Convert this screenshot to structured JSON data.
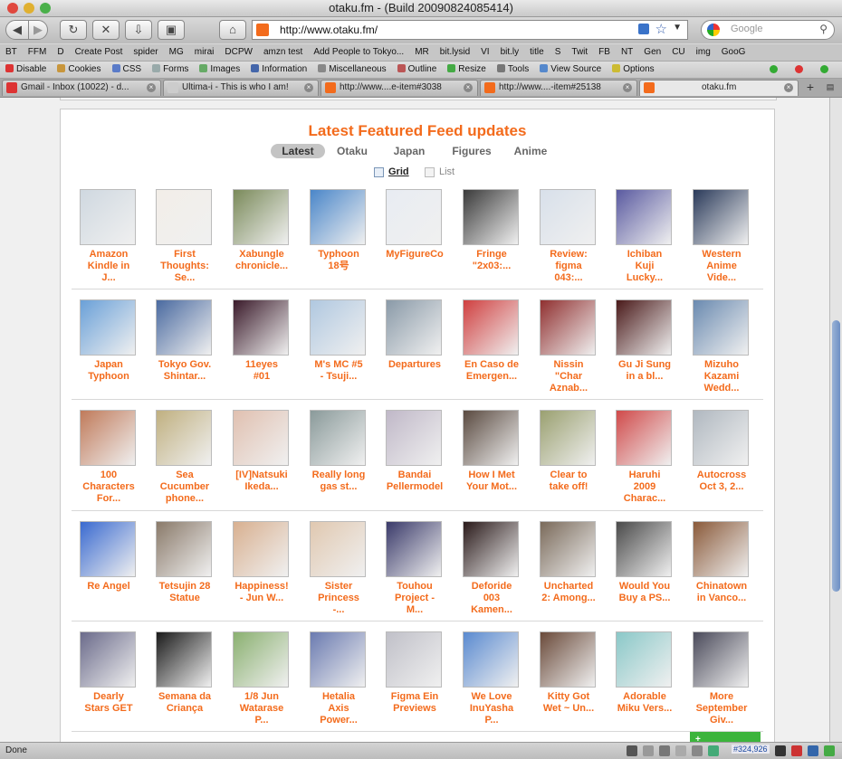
{
  "window": {
    "title": "otaku.fm - (Build 20090824085414)"
  },
  "nav": {
    "url": "http://www.otaku.fm/",
    "search_placeholder": "Google"
  },
  "bookmarks": [
    "BT",
    "FFM",
    "D",
    "Create Post",
    "spider",
    "MG",
    "mirai",
    "DCPW",
    "amzn test",
    "Add People to Tokyo...",
    "MR",
    "bit.lysid",
    "VI",
    "bit.ly",
    "title",
    "S",
    "Twit",
    "FB",
    "NT",
    "Gen",
    "CU",
    "img",
    "GooG"
  ],
  "webdev": [
    "Disable",
    "Cookies",
    "CSS",
    "Forms",
    "Images",
    "Information",
    "Miscellaneous",
    "Outline",
    "Resize",
    "Tools",
    "View Source",
    "Options"
  ],
  "tabs": [
    {
      "label": "Gmail - Inbox (10022) - d..."
    },
    {
      "label": "Ultima-i - This is who I am!"
    },
    {
      "label": "http://www....e-item#3038"
    },
    {
      "label": "http://www....-item#25138"
    },
    {
      "label": "otaku.fm"
    }
  ],
  "feed": {
    "title": "Latest Featured Feed updates",
    "tabs": [
      "Latest",
      "Otaku",
      "Japan",
      "Figures",
      "Anime"
    ],
    "active_tab": "Latest",
    "view_grid": "Grid",
    "view_list": "List",
    "items": [
      [
        "Amazon",
        "Kindle in",
        "J..."
      ],
      [
        "First",
        "Thoughts:",
        "Se..."
      ],
      [
        "Xabungle",
        "chronicle..."
      ],
      [
        "Typhoon",
        "18号"
      ],
      [
        "MyFigureCo"
      ],
      [
        "Fringe",
        "\"2x03:..."
      ],
      [
        "Review:",
        "figma",
        "043:..."
      ],
      [
        "Ichiban",
        "Kuji",
        "Lucky..."
      ],
      [
        "Western",
        "Anime",
        "Vide..."
      ],
      [
        "Japan",
        "Typhoon"
      ],
      [
        "Tokyo Gov.",
        "Shintar..."
      ],
      [
        "11eyes",
        "#01"
      ],
      [
        "M's MC #5",
        "- Tsuji..."
      ],
      [
        "Departures"
      ],
      [
        "En Caso de",
        "Emergen..."
      ],
      [
        "Nissin",
        "\"Char",
        "Aznab..."
      ],
      [
        "Gu Ji Sung",
        "in a bl..."
      ],
      [
        "Mizuho",
        "Kazami",
        "Wedd..."
      ],
      [
        "100",
        "Characters",
        "For..."
      ],
      [
        "Sea",
        "Cucumber",
        "phone..."
      ],
      [
        "[IV]Natsuki",
        "Ikeda..."
      ],
      [
        "Really long",
        "gas st..."
      ],
      [
        "Bandai",
        "Pellermodel"
      ],
      [
        "How I Met",
        "Your Mot..."
      ],
      [
        "Clear to",
        "take off!"
      ],
      [
        "Haruhi",
        "2009",
        "Charac..."
      ],
      [
        "Autocross",
        "Oct 3, 2..."
      ],
      [
        "Re Angel"
      ],
      [
        "Tetsujin 28",
        "Statue"
      ],
      [
        "Happiness!",
        "- Jun W..."
      ],
      [
        "Sister",
        "Princess",
        "-..."
      ],
      [
        "Touhou",
        "Project -",
        "M..."
      ],
      [
        "Deforide",
        "003",
        "Kamen..."
      ],
      [
        "Uncharted",
        "2: Among..."
      ],
      [
        "Would You",
        "Buy a PS..."
      ],
      [
        "Chinatown",
        "in Vanco..."
      ],
      [
        "Dearly",
        "Stars GET"
      ],
      [
        "Semana da",
        "Criança"
      ],
      [
        "1/8 Jun",
        "Watarase",
        "P..."
      ],
      [
        "Hetalia",
        "Axis",
        "Power..."
      ],
      [
        "Figma Ein",
        "Previews"
      ],
      [
        "We Love",
        "InuYasha",
        "P..."
      ],
      [
        "Kitty Got",
        "Wet ~ Un..."
      ],
      [
        "Adorable",
        "Miku Vers..."
      ],
      [
        "More",
        "September",
        "Giv..."
      ]
    ],
    "green_button": "+"
  },
  "status": {
    "text": "Done",
    "counter": "#324,926"
  },
  "colors": {
    "accent": "#f36b1c",
    "active_tab_bg": "#c4c4c4",
    "green": "#3cb43c"
  }
}
